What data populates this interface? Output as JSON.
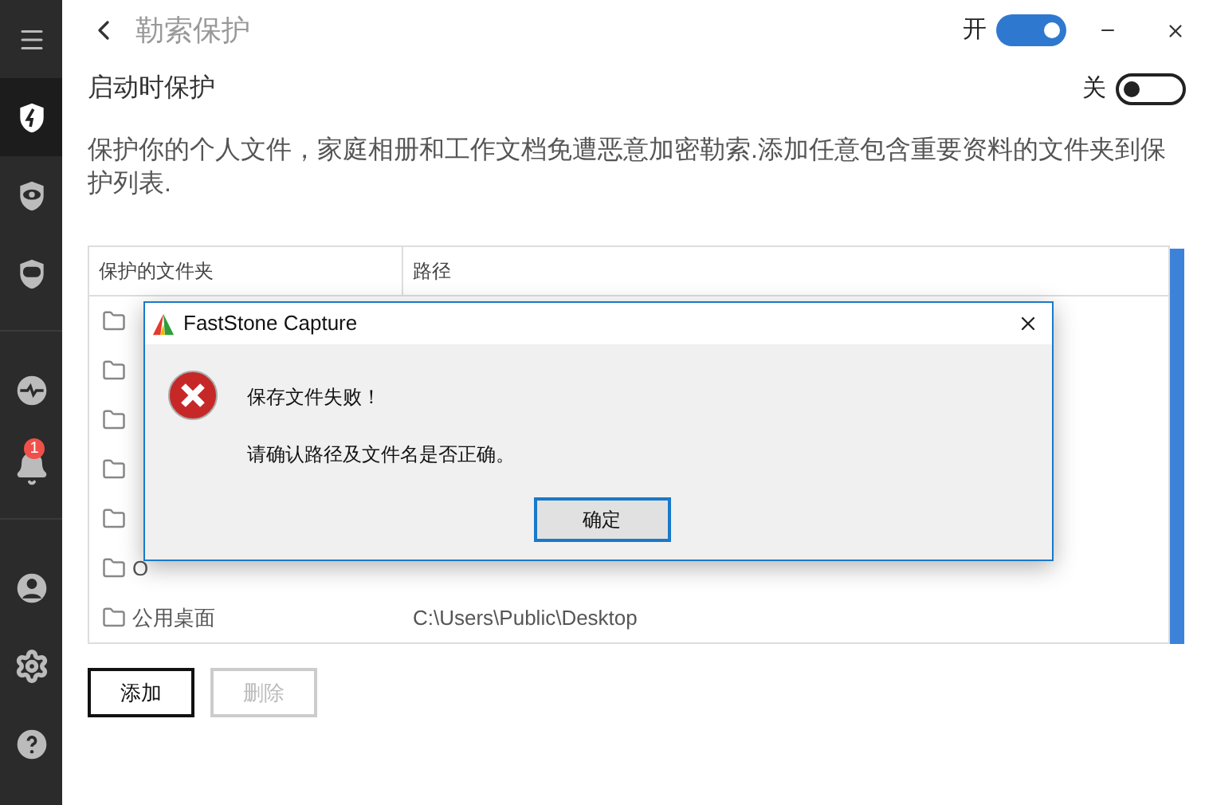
{
  "sidebar": {
    "items": [
      {
        "selected": false
      },
      {
        "selected": true
      },
      {
        "selected": false
      },
      {
        "selected": false
      },
      {
        "selected": false
      },
      {
        "selected": false,
        "badge": "1"
      },
      {
        "selected": false
      },
      {
        "selected": false
      },
      {
        "selected": false
      }
    ]
  },
  "header": {
    "title": "勒索保护",
    "master_toggle": {
      "label": "开",
      "on": true
    }
  },
  "startup": {
    "label": "启动时保护",
    "toggle": {
      "label": "关",
      "on": false
    }
  },
  "description": "保护你的个人文件，家庭相册和工作文档免遭恶意加密勒索.添加任意包含重要资料的文件夹到保护列表.",
  "table": {
    "columns": [
      "保护的文件夹",
      "路径"
    ],
    "rows": [
      {
        "kind": "folder"
      },
      {
        "kind": "folder"
      },
      {
        "kind": "folder"
      },
      {
        "kind": "folder"
      },
      {
        "kind": "folder"
      },
      {
        "kind": "folder",
        "name": "O"
      },
      {
        "kind": "folder",
        "name": "公用桌面",
        "path": "C:\\Users\\Public\\Desktop"
      }
    ]
  },
  "buttons": [
    {
      "label": "添加",
      "disabled": false
    },
    {
      "label": "删除",
      "disabled": true
    }
  ],
  "dialog": {
    "title": "FastStone Capture",
    "message": "保存文件失败！",
    "detail": "请确认路径及文件名是否正确。",
    "button": "确定"
  }
}
